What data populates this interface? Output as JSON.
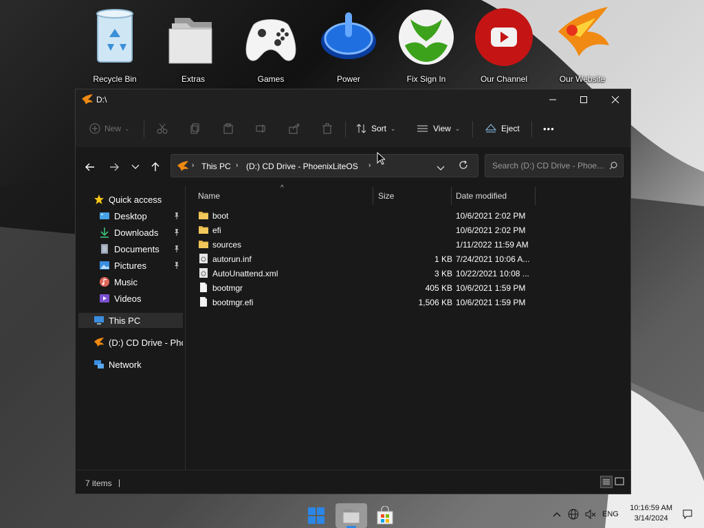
{
  "desktop": {
    "icons": [
      {
        "label": "Recycle Bin",
        "icon": "recycle-bin-icon"
      },
      {
        "label": "Extras",
        "icon": "folder-stack-icon"
      },
      {
        "label": "Games",
        "icon": "gamepad-icon"
      },
      {
        "label": "Power",
        "icon": "power-icon"
      },
      {
        "label": "Fix Sign In",
        "icon": "xbox-icon"
      },
      {
        "label": "Our Channel",
        "icon": "youtube-icon"
      },
      {
        "label": "Our Website",
        "icon": "phoenix-icon"
      }
    ]
  },
  "window": {
    "title": "D:\\",
    "controls": {
      "minimize": "—",
      "maximize": "☐",
      "close": "✕"
    }
  },
  "commandbar": {
    "new_label": "New",
    "sort_label": "Sort",
    "view_label": "View",
    "eject_label": "Eject",
    "more_label": "•••"
  },
  "address": {
    "crumbs": [
      "This PC",
      "(D:) CD Drive - PhoenixLiteOS"
    ],
    "search_placeholder": "Search (D:) CD Drive - Phoe..."
  },
  "sidebar": {
    "quick_access": "Quick access",
    "items": [
      {
        "label": "Desktop",
        "pinned": true
      },
      {
        "label": "Downloads",
        "pinned": true
      },
      {
        "label": "Documents",
        "pinned": true
      },
      {
        "label": "Pictures",
        "pinned": true
      },
      {
        "label": "Music",
        "pinned": false
      },
      {
        "label": "Videos",
        "pinned": false
      }
    ],
    "this_pc": "This PC",
    "drive": "(D:) CD Drive - Phoe",
    "network": "Network"
  },
  "columns": {
    "name": "Name",
    "size": "Size",
    "date": "Date modified"
  },
  "files": [
    {
      "name": "boot",
      "size": "",
      "date": "10/6/2021 2:02 PM",
      "type": "folder"
    },
    {
      "name": "efi",
      "size": "",
      "date": "10/6/2021 2:02 PM",
      "type": "folder"
    },
    {
      "name": "sources",
      "size": "",
      "date": "1/11/2022 11:59 AM",
      "type": "folder"
    },
    {
      "name": "autorun.inf",
      "size": "1 KB",
      "date": "7/24/2021 10:06 A...",
      "type": "settings"
    },
    {
      "name": "AutoUnattend.xml",
      "size": "3 KB",
      "date": "10/22/2021 10:08 ...",
      "type": "settings"
    },
    {
      "name": "bootmgr",
      "size": "405 KB",
      "date": "10/6/2021 1:59 PM",
      "type": "file"
    },
    {
      "name": "bootmgr.efi",
      "size": "1,506 KB",
      "date": "10/6/2021 1:59 PM",
      "type": "file"
    }
  ],
  "status": {
    "count": "7 items",
    "cursor": "|"
  },
  "taskbar": {
    "lang": "ENG",
    "time": "10:16:59 AM",
    "date": "3/14/2024"
  },
  "colors": {
    "accent": "#4aa3e8",
    "folder": "#e8b84a"
  }
}
